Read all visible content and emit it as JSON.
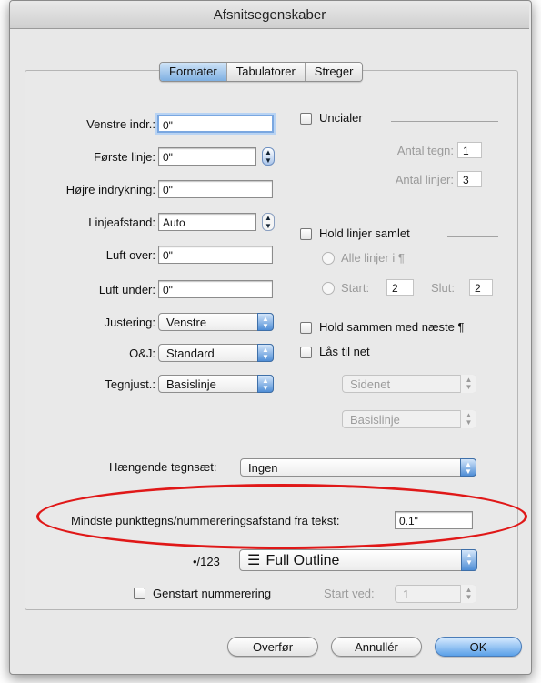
{
  "window": {
    "title": "Afsnitsegenskaber"
  },
  "tabs": [
    "Formater",
    "Tabulatorer",
    "Streger"
  ],
  "left": {
    "venstre_label": "Venstre indr.:",
    "venstre_value": "0\"",
    "forste_label": "Første linje:",
    "forste_value": "0\"",
    "hojre_label": "Højre indrykning:",
    "hojre_value": "0\"",
    "linjeafstand_label": "Linjeafstand:",
    "linjeafstand_value": "Auto",
    "luft_over_label": "Luft over:",
    "luft_over_value": "0\"",
    "luft_under_label": "Luft under:",
    "luft_under_value": "0\"",
    "justering_label": "Justering:",
    "justering_value": "Venstre",
    "oj_label": "O&J:",
    "oj_value": "Standard",
    "tegnjust_label": "Tegnjust.:",
    "tegnjust_value": "Basislinje"
  },
  "right": {
    "uncialer_label": "Uncialer",
    "antal_tegn_label": "Antal tegn:",
    "antal_tegn_value": "1",
    "antal_linjer_label": "Antal linjer:",
    "antal_linjer_value": "3",
    "hold_linjer_label": "Hold linjer samlet",
    "alle_linjer_label": "Alle linjer i ¶",
    "start_label": "Start:",
    "start_value": "2",
    "slut_label": "Slut:",
    "slut_value": "2",
    "hold_sammen_label": "Hold sammen med næste ¶",
    "las_til_net_label": "Lås til net",
    "sidenet_value": "Sidenet",
    "basislinje_value": "Basislinje"
  },
  "bottom": {
    "haengende_label": "Hængende tegnsæt:",
    "haengende_value": "Ingen",
    "mindste_label": "Mindste punkttegns/nummereringsafstand fra tekst:",
    "mindste_value": "0.1\"",
    "outline_label": "•/123",
    "outline_value": "Full Outline",
    "genstart_label": "Genstart nummerering",
    "start_ved_label": "Start ved:",
    "start_ved_value": "1"
  },
  "buttons": {
    "apply": "Overfør",
    "cancel": "Annullér",
    "ok": "OK"
  },
  "colors": {
    "focus_ring": "#7aa7e0",
    "highlight_ellipse": "#e01818",
    "default_button": "#5aa0e8"
  }
}
